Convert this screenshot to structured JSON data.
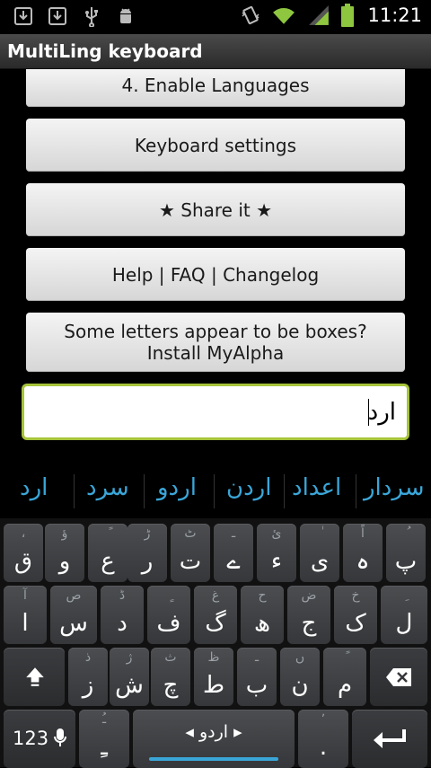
{
  "status_bar": {
    "time": "11:21"
  },
  "title_bar": {
    "title": "MultiLing keyboard"
  },
  "buttons": [
    {
      "label": "4. Enable Languages"
    },
    {
      "label": "Keyboard settings"
    },
    {
      "label": "★ Share it ★"
    },
    {
      "label": "Help | FAQ | Changelog"
    },
    {
      "label_line1": "Some letters appear to be boxes?",
      "label_line2": "Install MyAlpha"
    }
  ],
  "input": {
    "value": "ارد"
  },
  "suggestions": [
    "سردار",
    "اعداد",
    "اردن",
    "اردو",
    "سرد",
    "ارد"
  ],
  "keyboard": {
    "row1": [
      {
        "main": "پ",
        "sub": "ُ"
      },
      {
        "main": "ہ",
        "sub": "اً"
      },
      {
        "main": "ی",
        "sub": "ٰ"
      },
      {
        "main": "ء",
        "sub": "ئ"
      },
      {
        "main": "ے",
        "sub": "ـ"
      },
      {
        "main": "ت",
        "sub": "ٹ"
      },
      {
        "main": "ر",
        "sub": "ڑ"
      },
      {
        "main": "ع",
        "sub": "ً"
      },
      {
        "main": "و",
        "sub": "ؤ"
      },
      {
        "main": "ق",
        "sub": "،"
      }
    ],
    "row2": [
      {
        "main": "ل",
        "sub": "ِ"
      },
      {
        "main": "ک",
        "sub": "خ"
      },
      {
        "main": "ج",
        "sub": "ض"
      },
      {
        "main": "ھ",
        "sub": "ح"
      },
      {
        "main": "گ",
        "sub": "غ"
      },
      {
        "main": "ف",
        "sub": "ٍ"
      },
      {
        "main": "د",
        "sub": "ڈ"
      },
      {
        "main": "س",
        "sub": "ص"
      },
      {
        "main": "ا",
        "sub": "آ"
      }
    ],
    "row3": [
      {
        "main": "م",
        "sub": "ً"
      },
      {
        "main": "ن",
        "sub": "ں"
      },
      {
        "main": "ب",
        "sub": "ـ"
      },
      {
        "main": "ط",
        "sub": "ظ"
      },
      {
        "main": "چ",
        "sub": "ث"
      },
      {
        "main": "ش",
        "sub": "ژ"
      },
      {
        "main": "ز",
        "sub": "ذ"
      }
    ],
    "row4": {
      "mode_label": "123",
      "punct_left_main": "ـِ",
      "punct_left_sub": "ـُ",
      "space_label": "◂ اردو ▸",
      "punct_right_main": ".",
      "punct_right_sub": "ʼ"
    }
  },
  "icons": [
    "download-icon",
    "download-icon",
    "usb-icon",
    "android-debug-icon",
    "vibrate-icon",
    "wifi-icon",
    "signal-icon",
    "battery-icon",
    "shift-icon",
    "backspace-icon",
    "microphone-icon",
    "enter-icon"
  ],
  "colors": {
    "accent": "#3aa6d8",
    "input_border": "#a6c43a",
    "battery": "#8ec63f"
  }
}
